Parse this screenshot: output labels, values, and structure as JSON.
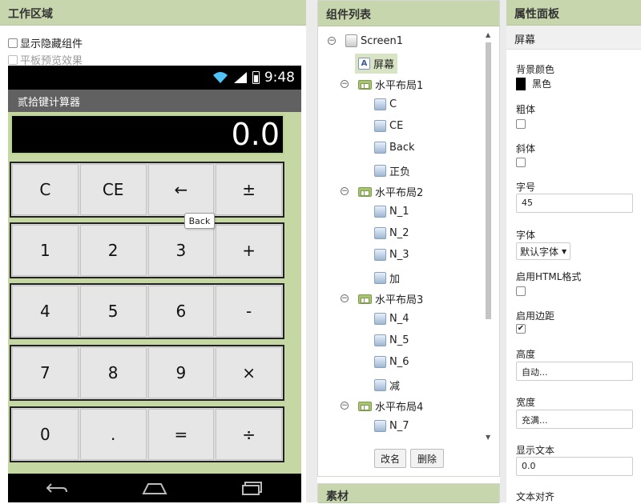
{
  "work_area": {
    "title": "工作区域",
    "show_hidden_label": "显示隐藏组件",
    "tablet_preview_label": "平板预览效果",
    "phone": {
      "time": "9:48",
      "app_title": "贰拾键计算器",
      "display_value": "0.0",
      "keys": [
        [
          "C",
          "CE",
          "←",
          "±"
        ],
        [
          "1",
          "2",
          "3",
          "+"
        ],
        [
          "4",
          "5",
          "6",
          "-"
        ],
        [
          "7",
          "8",
          "9",
          "×"
        ],
        [
          "0",
          ".",
          "=",
          "÷"
        ]
      ],
      "tooltip": "Back",
      "nav_icons": [
        "back-icon",
        "home-icon",
        "recent-apps-icon"
      ]
    }
  },
  "components": {
    "title": "组件列表",
    "tree": [
      {
        "label": "Screen1",
        "icon": "screen-icon",
        "toggle": "⊟"
      },
      {
        "label": "屏幕",
        "icon": "label-icon",
        "selected": true
      },
      {
        "label": "水平布局1",
        "icon": "layout-icon",
        "toggle": "⊟"
      },
      {
        "label": "C",
        "icon": "button-icon"
      },
      {
        "label": "CE",
        "icon": "button-icon"
      },
      {
        "label": "Back",
        "icon": "button-icon"
      },
      {
        "label": "正负",
        "icon": "button-icon"
      },
      {
        "label": "水平布局2",
        "icon": "layout-icon",
        "toggle": "⊟"
      },
      {
        "label": "N_1",
        "icon": "button-icon"
      },
      {
        "label": "N_2",
        "icon": "button-icon"
      },
      {
        "label": "N_3",
        "icon": "button-icon"
      },
      {
        "label": "加",
        "icon": "button-icon"
      },
      {
        "label": "水平布局3",
        "icon": "layout-icon",
        "toggle": "⊟"
      },
      {
        "label": "N_4",
        "icon": "button-icon"
      },
      {
        "label": "N_5",
        "icon": "button-icon"
      },
      {
        "label": "N_6",
        "icon": "button-icon"
      },
      {
        "label": "减",
        "icon": "button-icon"
      },
      {
        "label": "水平布局4",
        "icon": "layout-icon",
        "toggle": "⊟"
      },
      {
        "label": "N_7",
        "icon": "button-icon"
      }
    ],
    "rename_button": "改名",
    "delete_button": "删除"
  },
  "assets": {
    "title": "素材"
  },
  "properties": {
    "title": "属性面板",
    "component_name": "屏幕",
    "background_color_label": "背景颜色",
    "background_color_value": "黑色",
    "background_color_hex": "#000000",
    "bold_label": "粗体",
    "bold_checked": false,
    "italic_label": "斜体",
    "italic_checked": false,
    "font_size_label": "字号",
    "font_size_value": "45",
    "font_typeface_label": "字体",
    "font_typeface_value": "默认字体",
    "html_format_label": "启用HTML格式",
    "html_format_checked": false,
    "has_margins_label": "启用边距",
    "has_margins_checked": true,
    "height_label": "高度",
    "height_value": "自动...",
    "width_label": "宽度",
    "width_value": "充满...",
    "text_label": "显示文本",
    "text_value": "0.0",
    "text_align_label": "文本对齐"
  }
}
